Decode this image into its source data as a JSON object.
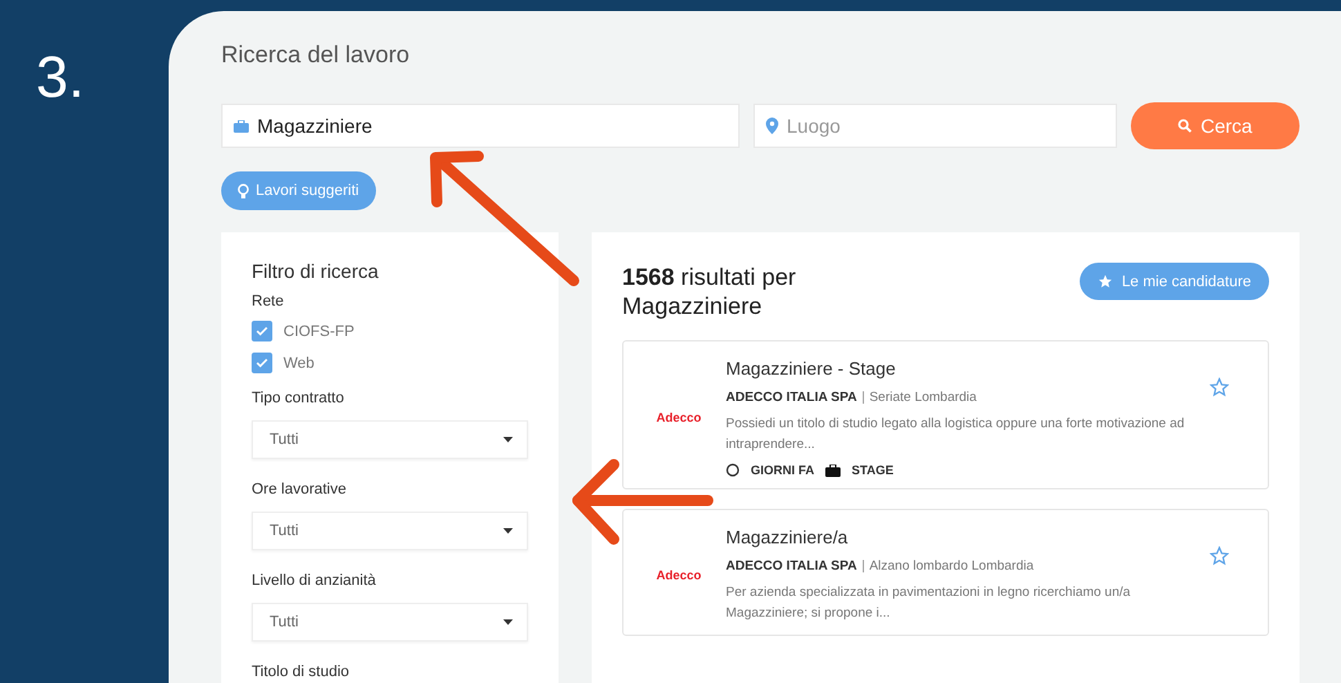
{
  "step": "3.",
  "page": {
    "title": "Ricerca del lavoro"
  },
  "search": {
    "job_value": "Magazziniere",
    "place_placeholder": "Luogo",
    "submit": "Cerca",
    "suggested": "Lavori suggeriti"
  },
  "filters": {
    "title": "Filtro di ricerca",
    "groups": [
      {
        "kind": "checkbox",
        "label": "Rete",
        "options": [
          {
            "label": "CIOFS-FP",
            "checked": true
          },
          {
            "label": "Web",
            "checked": true
          }
        ]
      },
      {
        "kind": "select",
        "label": "Tipo contratto",
        "value": "Tutti"
      },
      {
        "kind": "select",
        "label": "Ore lavorative",
        "value": "Tutti"
      },
      {
        "kind": "select",
        "label": "Livello di anzianità",
        "value": "Tutti"
      },
      {
        "kind": "select",
        "label": "Titolo di studio"
      }
    ]
  },
  "results": {
    "heading": "**1568** risultati per Magazziniere",
    "applications_button": "Le mie candidature",
    "jobs": [
      {
        "logo": "Adecco",
        "title": "Magazziniere - Stage",
        "company": "ADECCO ITALIA SPA",
        "location": "Seriate Lombardia",
        "description": "Possiedi un titolo di studio legato alla logistica oppure una forte motivazione ad intraprendere...",
        "age": "GIORNI FA",
        "type": "STAGE",
        "favorite": false
      },
      {
        "logo": "Adecco",
        "title": "Magazziniere/a",
        "company": "ADECCO ITALIA SPA",
        "location": "Alzano lombardo Lombardia",
        "description": "Per azienda specializzata in pavimentazioni in legno ricerchiamo un/a Magazziniere; si propone i...",
        "favorite": false
      }
    ]
  }
}
